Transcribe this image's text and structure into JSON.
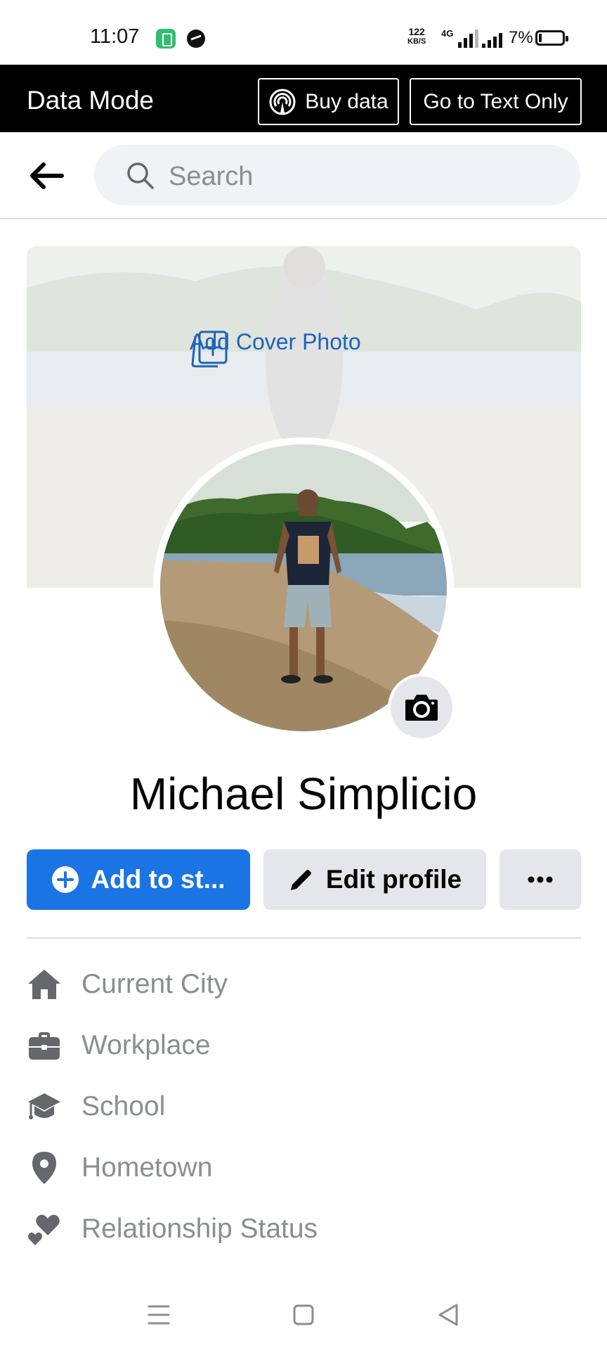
{
  "status_bar": {
    "time": "11:07",
    "speed_value": "122",
    "speed_unit": "KB/S",
    "network": "4G",
    "battery": "7%"
  },
  "data_mode": {
    "title": "Data Mode",
    "buy_label": "Buy data",
    "text_only_label": "Go to Text Only"
  },
  "search": {
    "placeholder": "Search"
  },
  "cover": {
    "add_label": "Add Cover Photo"
  },
  "profile": {
    "name": "Michael Simplicio"
  },
  "actions": {
    "add_story": "Add to st...",
    "edit_profile": "Edit profile"
  },
  "details": [
    {
      "label": "Current City",
      "icon": "home-icon"
    },
    {
      "label": "Workplace",
      "icon": "briefcase-icon"
    },
    {
      "label": "School",
      "icon": "graduation-cap-icon"
    },
    {
      "label": "Hometown",
      "icon": "location-pin-icon"
    },
    {
      "label": "Relationship Status",
      "icon": "hearts-icon"
    }
  ],
  "colors": {
    "accent": "#1b74e4",
    "secondary_button": "#e4e6eb",
    "muted_text": "#8a8d91",
    "link_blue": "#1d64b8"
  }
}
